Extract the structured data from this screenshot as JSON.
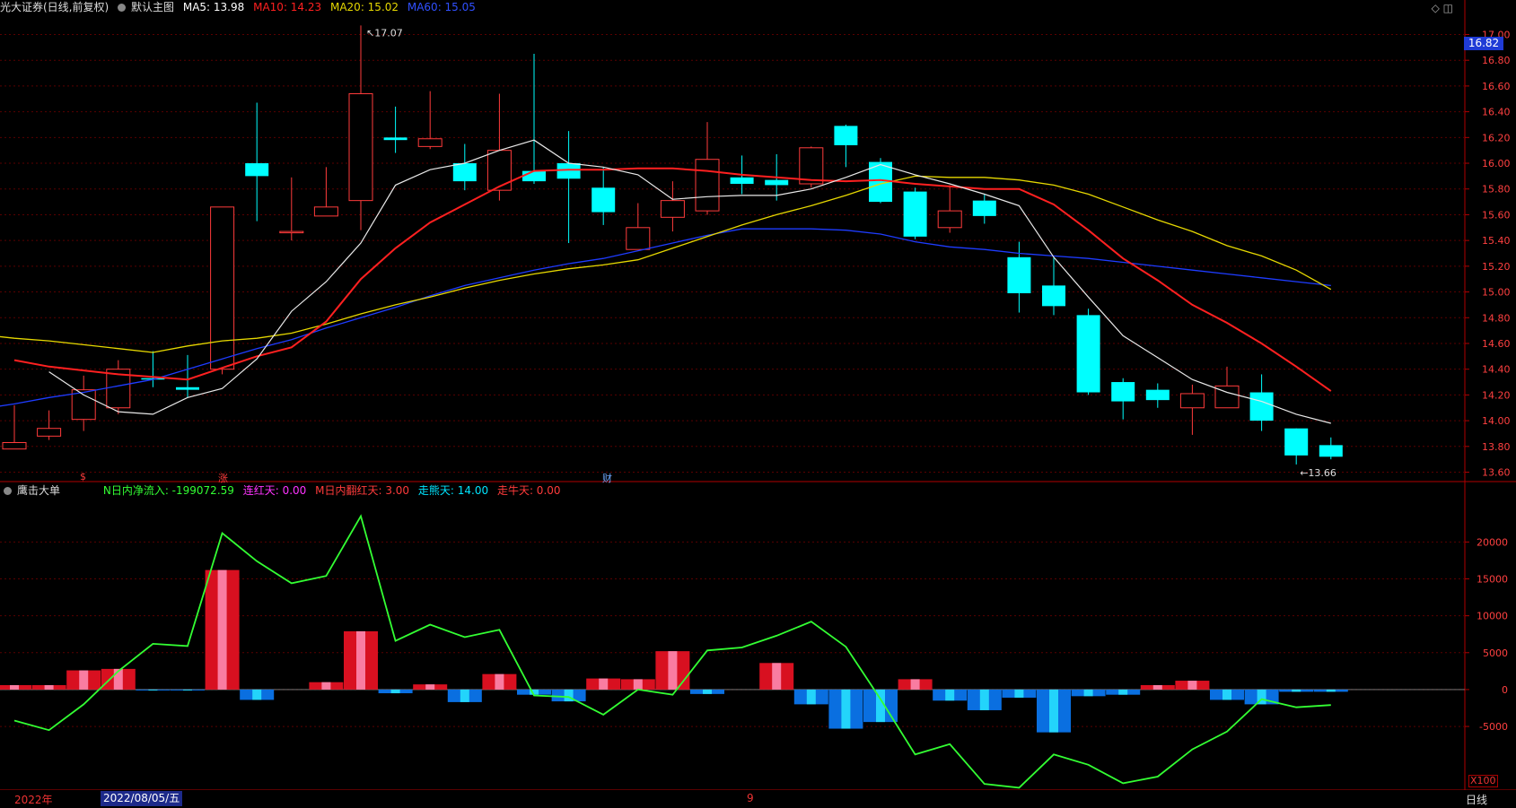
{
  "main_header": {
    "title": "光大证券(日线,前复权)",
    "indicator": "默认主图",
    "ma5": "MA5: 13.98",
    "ma10": "MA10: 14.23",
    "ma20": "MA20: 15.02",
    "ma60": "MA60: 15.05"
  },
  "sub_header": {
    "indicator": "鹰击大单",
    "n_flow": "N日内净流入: -199072.59",
    "lianhong": "连红天: 0.00",
    "m_red": "M日内翻红天: 3.00",
    "zouxiong": "走熊天: 14.00",
    "zouniu": "走牛天: 0.00"
  },
  "top_icons": "◇ ◫",
  "current_price": "16.82",
  "marks": {
    "s": "$",
    "zhang": "涨",
    "cai": "财"
  },
  "annotations": {
    "high": "17.07",
    "low": "13.66"
  },
  "bottom": {
    "year": "2022年",
    "date": "2022/08/05/五",
    "month": "9",
    "period": "日线",
    "scale": "X100"
  },
  "colors": {
    "up": "#ff3b3b",
    "down": "#00ffff",
    "ma5": "#e8e8e8",
    "ma10": "#ff2020",
    "ma20": "#e6d800",
    "ma60": "#1e3cff",
    "flow": "#33ff33",
    "grid": "#5a0000"
  },
  "chart_data": [
    {
      "type": "candlestick",
      "title": "光大证券(日线,前复权)",
      "y_ticks": [
        13.6,
        13.8,
        14.0,
        14.2,
        14.4,
        14.6,
        14.8,
        15.0,
        15.2,
        15.4,
        15.6,
        15.8,
        16.0,
        16.2,
        16.4,
        16.6,
        16.8,
        17.0
      ],
      "ylim": [
        13.52,
        17.08
      ],
      "candles": [
        {
          "o": 13.78,
          "c": 13.83,
          "h": 14.12,
          "l": 13.78
        },
        {
          "o": 13.88,
          "c": 13.94,
          "h": 14.08,
          "l": 13.85
        },
        {
          "o": 14.01,
          "c": 14.24,
          "h": 14.35,
          "l": 13.92
        },
        {
          "o": 14.1,
          "c": 14.4,
          "h": 14.47,
          "l": 14.05
        },
        {
          "o": 14.33,
          "c": 14.32,
          "h": 14.54,
          "l": 14.26
        },
        {
          "o": 14.26,
          "c": 14.24,
          "h": 14.51,
          "l": 14.18
        },
        {
          "o": 14.4,
          "c": 15.66,
          "h": 15.66,
          "l": 14.36
        },
        {
          "o": 16.0,
          "c": 15.9,
          "h": 16.47,
          "l": 15.55
        },
        {
          "o": 15.47,
          "c": 15.47,
          "h": 15.89,
          "l": 15.4
        },
        {
          "o": 15.59,
          "c": 15.66,
          "h": 15.97,
          "l": 15.59
        },
        {
          "o": 15.71,
          "c": 16.54,
          "h": 17.07,
          "l": 15.48
        },
        {
          "o": 16.2,
          "c": 16.18,
          "h": 16.44,
          "l": 16.08
        },
        {
          "o": 16.13,
          "c": 16.19,
          "h": 16.56,
          "l": 16.11
        },
        {
          "o": 16.0,
          "c": 15.86,
          "h": 16.15,
          "l": 15.79
        },
        {
          "o": 15.79,
          "c": 16.1,
          "h": 16.54,
          "l": 15.71
        },
        {
          "o": 15.94,
          "c": 15.86,
          "h": 16.85,
          "l": 15.84
        },
        {
          "o": 16.0,
          "c": 15.88,
          "h": 16.25,
          "l": 15.38
        },
        {
          "o": 15.81,
          "c": 15.62,
          "h": 15.97,
          "l": 15.52
        },
        {
          "o": 15.33,
          "c": 15.5,
          "h": 15.69,
          "l": 15.33
        },
        {
          "o": 15.58,
          "c": 15.71,
          "h": 15.86,
          "l": 15.47
        },
        {
          "o": 15.63,
          "c": 16.03,
          "h": 16.32,
          "l": 15.6
        },
        {
          "o": 15.89,
          "c": 15.84,
          "h": 16.06,
          "l": 15.76
        },
        {
          "o": 15.87,
          "c": 15.83,
          "h": 16.07,
          "l": 15.71
        },
        {
          "o": 15.84,
          "c": 16.12,
          "h": 16.13,
          "l": 15.81
        },
        {
          "o": 16.29,
          "c": 16.14,
          "h": 16.3,
          "l": 15.97
        },
        {
          "o": 16.01,
          "c": 15.7,
          "h": 16.04,
          "l": 15.69
        },
        {
          "o": 15.78,
          "c": 15.43,
          "h": 15.81,
          "l": 15.41
        },
        {
          "o": 15.5,
          "c": 15.63,
          "h": 15.83,
          "l": 15.46
        },
        {
          "o": 15.71,
          "c": 15.59,
          "h": 15.76,
          "l": 15.53
        },
        {
          "o": 15.27,
          "c": 14.99,
          "h": 15.39,
          "l": 14.84
        },
        {
          "o": 15.05,
          "c": 14.89,
          "h": 15.27,
          "l": 14.82
        },
        {
          "o": 14.82,
          "c": 14.22,
          "h": 14.87,
          "l": 14.2
        },
        {
          "o": 14.3,
          "c": 14.15,
          "h": 14.33,
          "l": 14.01
        },
        {
          "o": 14.24,
          "c": 14.16,
          "h": 14.29,
          "l": 14.1
        },
        {
          "o": 14.1,
          "c": 14.21,
          "h": 14.28,
          "l": 13.89
        },
        {
          "o": 14.1,
          "c": 14.27,
          "h": 14.42,
          "l": 14.1
        },
        {
          "o": 14.22,
          "c": 14.0,
          "h": 14.36,
          "l": 13.92
        },
        {
          "o": 13.94,
          "c": 13.73,
          "h": 13.94,
          "l": 13.66
        },
        {
          "o": 13.81,
          "c": 13.72,
          "h": 13.87,
          "l": 13.7
        }
      ],
      "ma5": [
        14.38,
        14.2,
        14.07,
        14.05,
        14.18,
        14.25,
        14.48,
        14.85,
        15.08,
        15.38,
        15.83,
        15.95,
        16.0,
        16.1,
        16.18,
        16.0,
        15.97,
        15.91,
        15.72,
        15.74,
        15.75,
        15.75,
        15.8,
        15.89,
        15.99,
        15.91,
        15.84,
        15.76,
        15.67,
        15.27,
        14.96,
        14.66,
        14.49,
        14.32,
        14.22,
        14.15,
        14.05,
        13.98
      ],
      "ma10": [
        14.47,
        14.42,
        14.39,
        14.36,
        14.34,
        14.32,
        14.41,
        14.5,
        14.57,
        14.77,
        15.1,
        15.34,
        15.54,
        15.68,
        15.82,
        15.94,
        15.95,
        15.95,
        15.96,
        15.96,
        15.94,
        15.91,
        15.89,
        15.87,
        15.86,
        15.87,
        15.84,
        15.82,
        15.8,
        15.8,
        15.68,
        15.48,
        15.26,
        15.09,
        14.9,
        14.76,
        14.6,
        14.42,
        14.23
      ],
      "ma20": [
        14.71,
        14.67,
        14.64,
        14.62,
        14.59,
        14.56,
        14.53,
        14.58,
        14.62,
        14.64,
        14.68,
        14.75,
        14.83,
        14.9,
        14.96,
        15.03,
        15.09,
        15.14,
        15.18,
        15.21,
        15.25,
        15.34,
        15.43,
        15.52,
        15.6,
        15.67,
        15.75,
        15.84,
        15.9,
        15.89,
        15.89,
        15.87,
        15.83,
        15.76,
        15.66,
        15.56,
        15.47,
        15.36,
        15.28,
        15.17,
        15.02
      ],
      "ma60": [
        14.05,
        14.09,
        14.13,
        14.18,
        14.22,
        14.27,
        14.32,
        14.4,
        14.48,
        14.56,
        14.63,
        14.72,
        14.8,
        14.88,
        14.97,
        15.05,
        15.11,
        15.17,
        15.22,
        15.26,
        15.32,
        15.38,
        15.44,
        15.49,
        15.49,
        15.49,
        15.48,
        15.45,
        15.39,
        15.35,
        15.33,
        15.3,
        15.28,
        15.26,
        15.23,
        15.2,
        15.17,
        15.14,
        15.11,
        15.08,
        15.05
      ]
    },
    {
      "type": "bar",
      "title": "鹰击大单",
      "y_ticks": [
        -5000,
        0,
        5000,
        10000,
        15000,
        20000
      ],
      "ylim": [
        -13500,
        26000
      ],
      "bars": [
        600,
        600,
        2600,
        2800,
        -100,
        -100,
        16200,
        -1400,
        0,
        1000,
        7900,
        -500,
        700,
        -1700,
        2100,
        -700,
        -1600,
        1500,
        1400,
        5200,
        -600,
        0,
        3600,
        -2000,
        -5300,
        -4400,
        1400,
        -1500,
        -2800,
        -1100,
        -5800,
        -900,
        -700,
        600,
        1200,
        -1400,
        -2000,
        -300,
        -300
      ],
      "flow_line": [
        -4200,
        -5500,
        -2000,
        2500,
        6200,
        5900,
        21200,
        17400,
        14400,
        15400,
        23500,
        6600,
        8800,
        7100,
        8100,
        -800,
        -1000,
        -3400,
        0,
        -700,
        5300,
        5700,
        7300,
        9200,
        5800,
        -1300,
        -8800,
        -7400,
        -12800,
        -13300,
        -8800,
        -10200,
        -12700,
        -11800,
        -8100,
        -5700,
        -1300,
        -2400,
        -2100
      ]
    }
  ]
}
